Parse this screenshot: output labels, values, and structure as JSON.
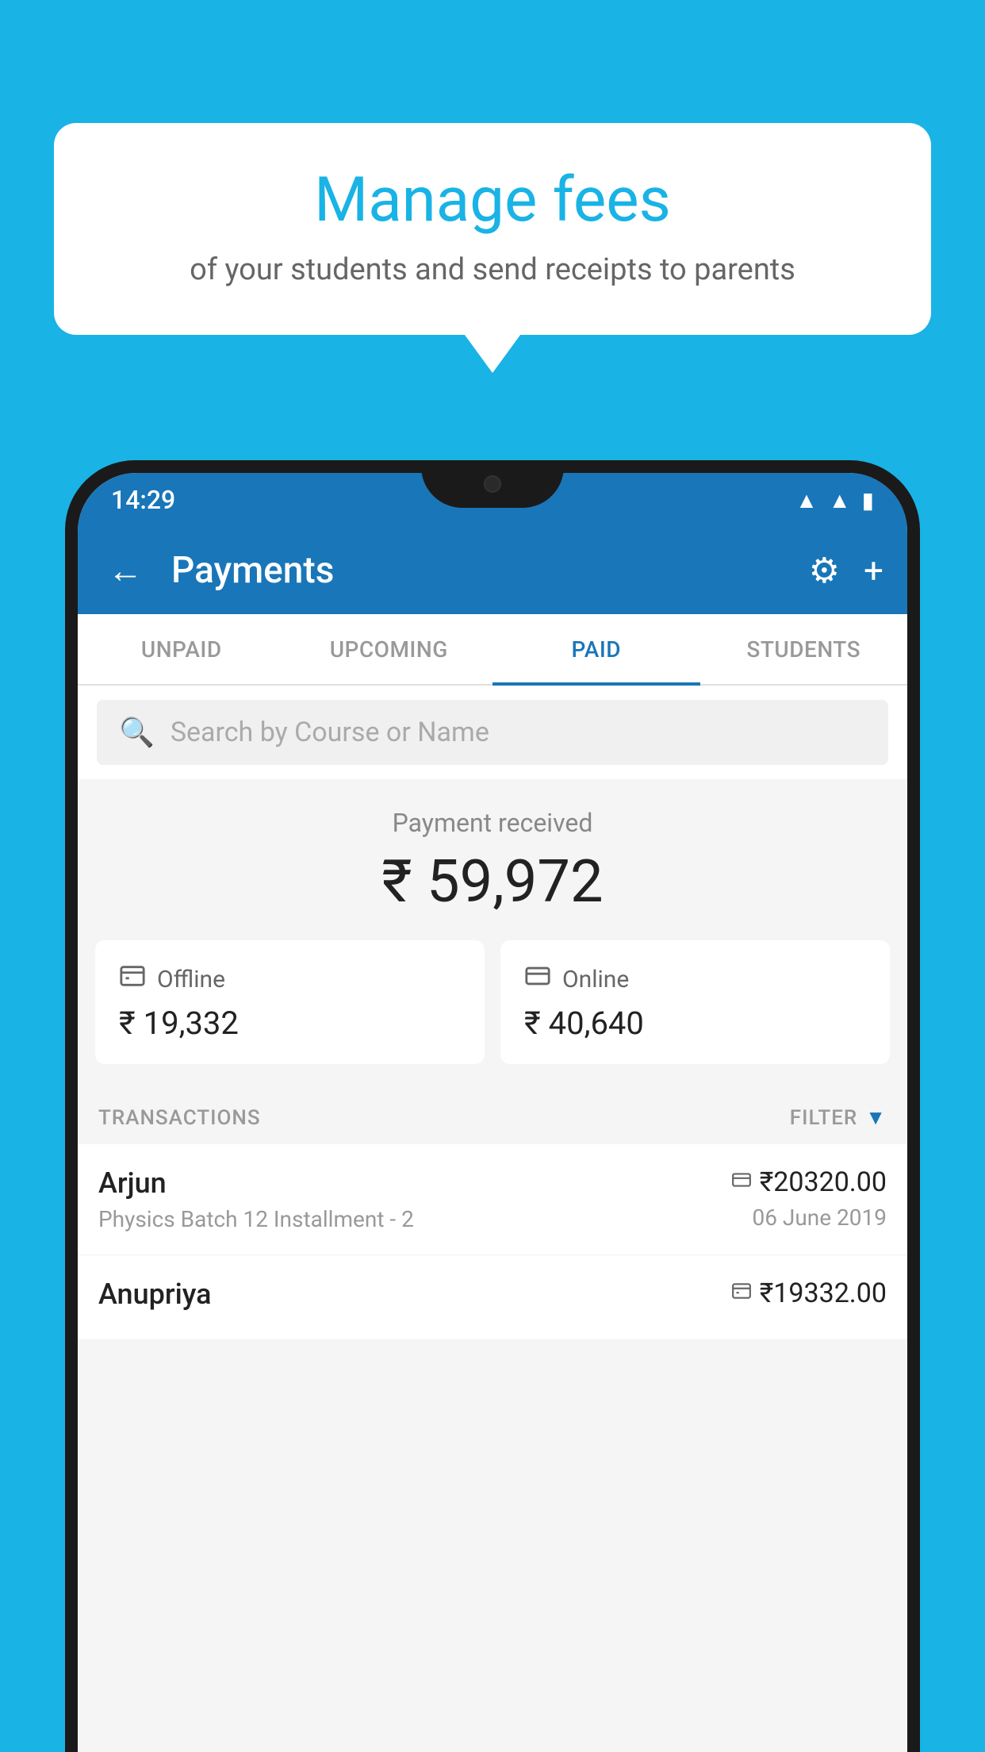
{
  "background_color": "#19b3e6",
  "speech_bubble": {
    "title": "Manage fees",
    "subtitle": "of your students and send receipts to parents"
  },
  "status_bar": {
    "time": "14:29",
    "wifi_icon": "▲",
    "signal_icon": "▲",
    "battery_icon": "▮"
  },
  "app_bar": {
    "back_label": "←",
    "title": "Payments",
    "settings_label": "⚙",
    "add_label": "+"
  },
  "tabs": [
    {
      "label": "UNPAID",
      "active": false
    },
    {
      "label": "UPCOMING",
      "active": false
    },
    {
      "label": "PAID",
      "active": true
    },
    {
      "label": "STUDENTS",
      "active": false
    }
  ],
  "search": {
    "placeholder": "Search by Course or Name"
  },
  "payment_received": {
    "label": "Payment received",
    "amount": "₹ 59,972"
  },
  "payment_cards": [
    {
      "icon": "💳",
      "label": "Offline",
      "amount": "₹ 19,332"
    },
    {
      "icon": "💳",
      "label": "Online",
      "amount": "₹ 40,640"
    }
  ],
  "transactions_header": {
    "label": "TRANSACTIONS",
    "filter_label": "FILTER"
  },
  "transactions": [
    {
      "name": "Arjun",
      "detail": "Physics Batch 12 Installment - 2",
      "amount": "₹20320.00",
      "date": "06 June 2019",
      "type": "online"
    },
    {
      "name": "Anupriya",
      "detail": "",
      "amount": "₹19332.00",
      "date": "",
      "type": "offline"
    }
  ]
}
